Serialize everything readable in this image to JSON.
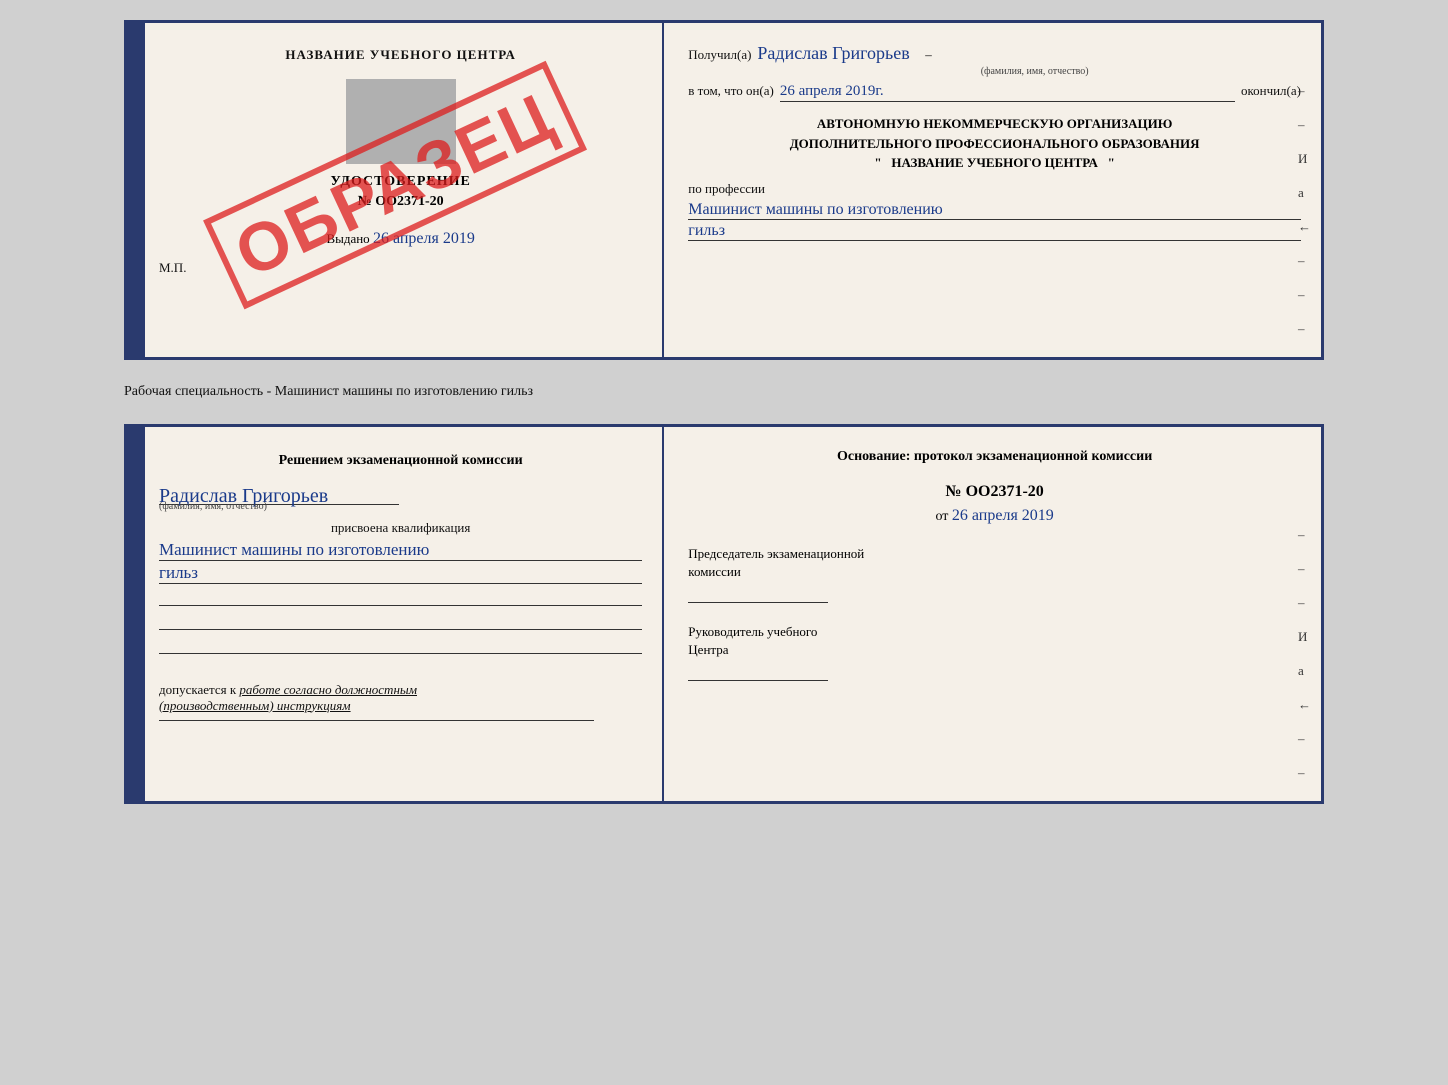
{
  "top_card": {
    "left": {
      "center_title": "НАЗВАНИЕ УЧЕБНОГО ЦЕНТРА",
      "cert_label": "УДОСТОВЕРЕНИЕ",
      "cert_number": "№ OO2371-20",
      "issued_label": "Выдано",
      "issued_date": "26 апреля 2019",
      "mp_label": "М.П.",
      "obrazec": "ОБРАЗЕЦ"
    },
    "right": {
      "received_label": "Получил(а)",
      "recipient_name": "Радислав Григорьев",
      "recipient_sub": "(фамилия, имя, отчество)",
      "dash": "–",
      "date_prefix": "в том, что он(а)",
      "date_value": "26 апреля 2019г.",
      "finished_label": "окончил(а)",
      "org_block": "АВТОНОМНУЮ НЕКОММЕРЧЕСКУЮ ОРГАНИЗАЦИЮ\nДОПОЛНИТЕЛЬНОГО ПРОФЕССИОНАЛЬНОГО ОБРАЗОВАНИЯ\n\"   НАЗВАНИЕ УЧЕБНОГО ЦЕНТРА   \"",
      "profession_prefix": "по профессии",
      "profession_value1": "Машинист машины по изготовлению",
      "profession_value2": "гильз"
    }
  },
  "separator": {
    "text": "Рабочая специальность - Машинист машины по изготовлению гильз"
  },
  "bottom_card": {
    "left": {
      "decision_title": "Решением  экзаменационной  комиссии",
      "person_name": "Радислав Григорьев",
      "person_sub": "(фамилия, имя, отчество)",
      "assigned_label": "присвоена квалификация",
      "qualification1": "Машинист  машины  по изготовлению",
      "qualification2": "гильз",
      "allowed_prefix": "допускается к",
      "allowed_value": "работе согласно должностным\n(производственным) инструкциям"
    },
    "right": {
      "basis_title": "Основание: протокол экзаменационной  комиссии",
      "protocol_number": "№  OO2371-20",
      "date_prefix": "от",
      "protocol_date": "26 апреля 2019",
      "chairman_label": "Председатель экзаменационной\nкомиссии",
      "head_label": "Руководитель учебного\nЦентра"
    }
  },
  "right_margin_chars": [
    "–",
    "И",
    "а",
    "←",
    "–",
    "–",
    "–"
  ]
}
